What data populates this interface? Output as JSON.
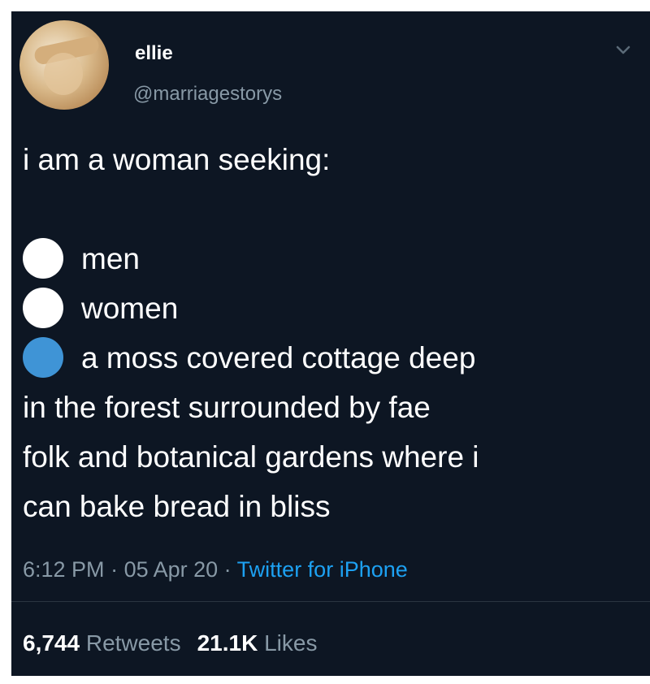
{
  "user": {
    "display_name": "ellie",
    "handle": "@marriagestorys"
  },
  "tweet": {
    "intro": "i am a woman seeking:",
    "options": [
      {
        "label": "men",
        "selected": false
      },
      {
        "label": "women",
        "selected": false
      },
      {
        "label": "a moss covered cottage deep",
        "selected": true
      }
    ],
    "continuation": [
      "in the forest surrounded by fae",
      "folk and botanical gardens where i",
      "can bake bread in bliss"
    ]
  },
  "meta": {
    "time": "6:12 PM",
    "sep1": " · ",
    "date": "05 Apr 20",
    "sep2": " · ",
    "source": "Twitter for iPhone"
  },
  "stats": {
    "retweets_count": "6,744",
    "retweets_label": "Retweets",
    "likes_count": "21.1K",
    "likes_label": "Likes"
  },
  "colors": {
    "background": "#0d1623",
    "text": "#ffffff",
    "muted": "#8899a6",
    "link": "#1da1f2",
    "selected_radio": "#3f94d6"
  },
  "icons": {
    "menu_chevron": "chevron-down-icon",
    "avatar": "profile-photo"
  }
}
